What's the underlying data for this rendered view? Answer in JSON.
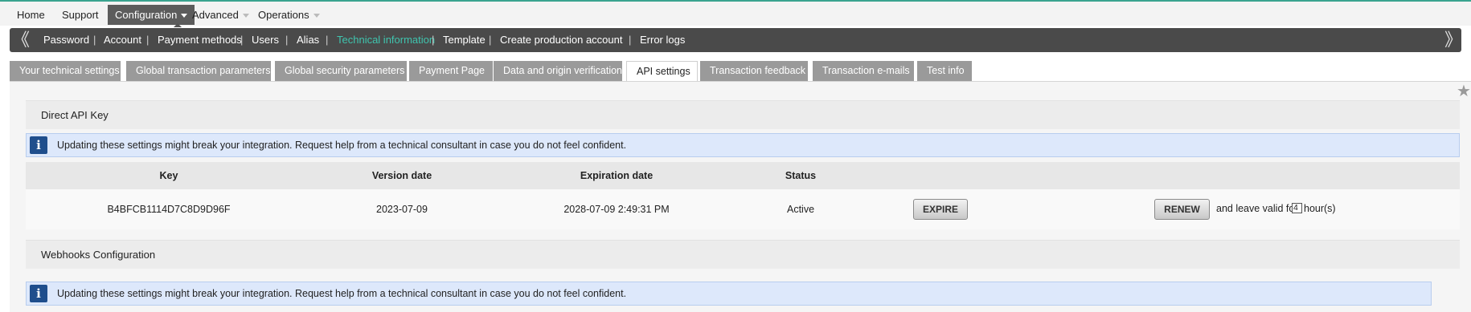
{
  "top_nav": {
    "items": [
      {
        "label": "Home"
      },
      {
        "label": "Support"
      },
      {
        "label": "Configuration",
        "active": true
      },
      {
        "label": "Advanced"
      },
      {
        "label": "Operations"
      }
    ]
  },
  "sub_nav": {
    "items": [
      {
        "label": "Password"
      },
      {
        "label": "Account"
      },
      {
        "label": "Payment methods"
      },
      {
        "label": "Users"
      },
      {
        "label": "Alias"
      },
      {
        "label": "Technical information",
        "active": true
      },
      {
        "label": "Template"
      },
      {
        "label": "Create production account"
      },
      {
        "label": "Error logs"
      }
    ],
    "separator": "|",
    "prev_arrow": "《",
    "next_arrow": "》"
  },
  "tabs": [
    {
      "label": "Your technical settings"
    },
    {
      "label": "Global transaction parameters"
    },
    {
      "label": "Global security parameters"
    },
    {
      "label": "Payment Page"
    },
    {
      "label": "Data and origin verification"
    },
    {
      "label": "API settings",
      "active": true
    },
    {
      "label": "Transaction feedback"
    },
    {
      "label": "Transaction e-mails"
    },
    {
      "label": "Test info"
    }
  ],
  "favorite_icon": "★",
  "direct_api": {
    "title": "Direct API Key",
    "info_icon": "i",
    "info": "Updating these settings might break your integration. Request help from a technical consultant in case you do not feel confident.",
    "columns": {
      "key": "Key",
      "version_date": "Version date",
      "expiration_date": "Expiration date",
      "status": "Status"
    },
    "row": {
      "key": "B4BFCB1114D7C8D9D96F",
      "version_date": "2023-07-09",
      "expiration_date": "2028-07-09 2:49:31 PM",
      "status": "Active"
    },
    "expire_label": "EXPIRE",
    "renew_label": "RENEW",
    "leave_text": "and leave valid for",
    "hours_value": "4",
    "hours_label": "hour(s)"
  },
  "webhooks": {
    "title": "Webhooks Configuration",
    "info_icon": "i",
    "info": "Updating these settings might break your integration. Request help from a technical consultant in case you do not feel confident."
  },
  "colors": {
    "accent": "#3fc4ae",
    "nav_dark": "#4a4a4a",
    "tab_grey": "#9a9a9a",
    "info_bg": "#dde8fb",
    "info_icon_bg": "#1f4e8c"
  }
}
